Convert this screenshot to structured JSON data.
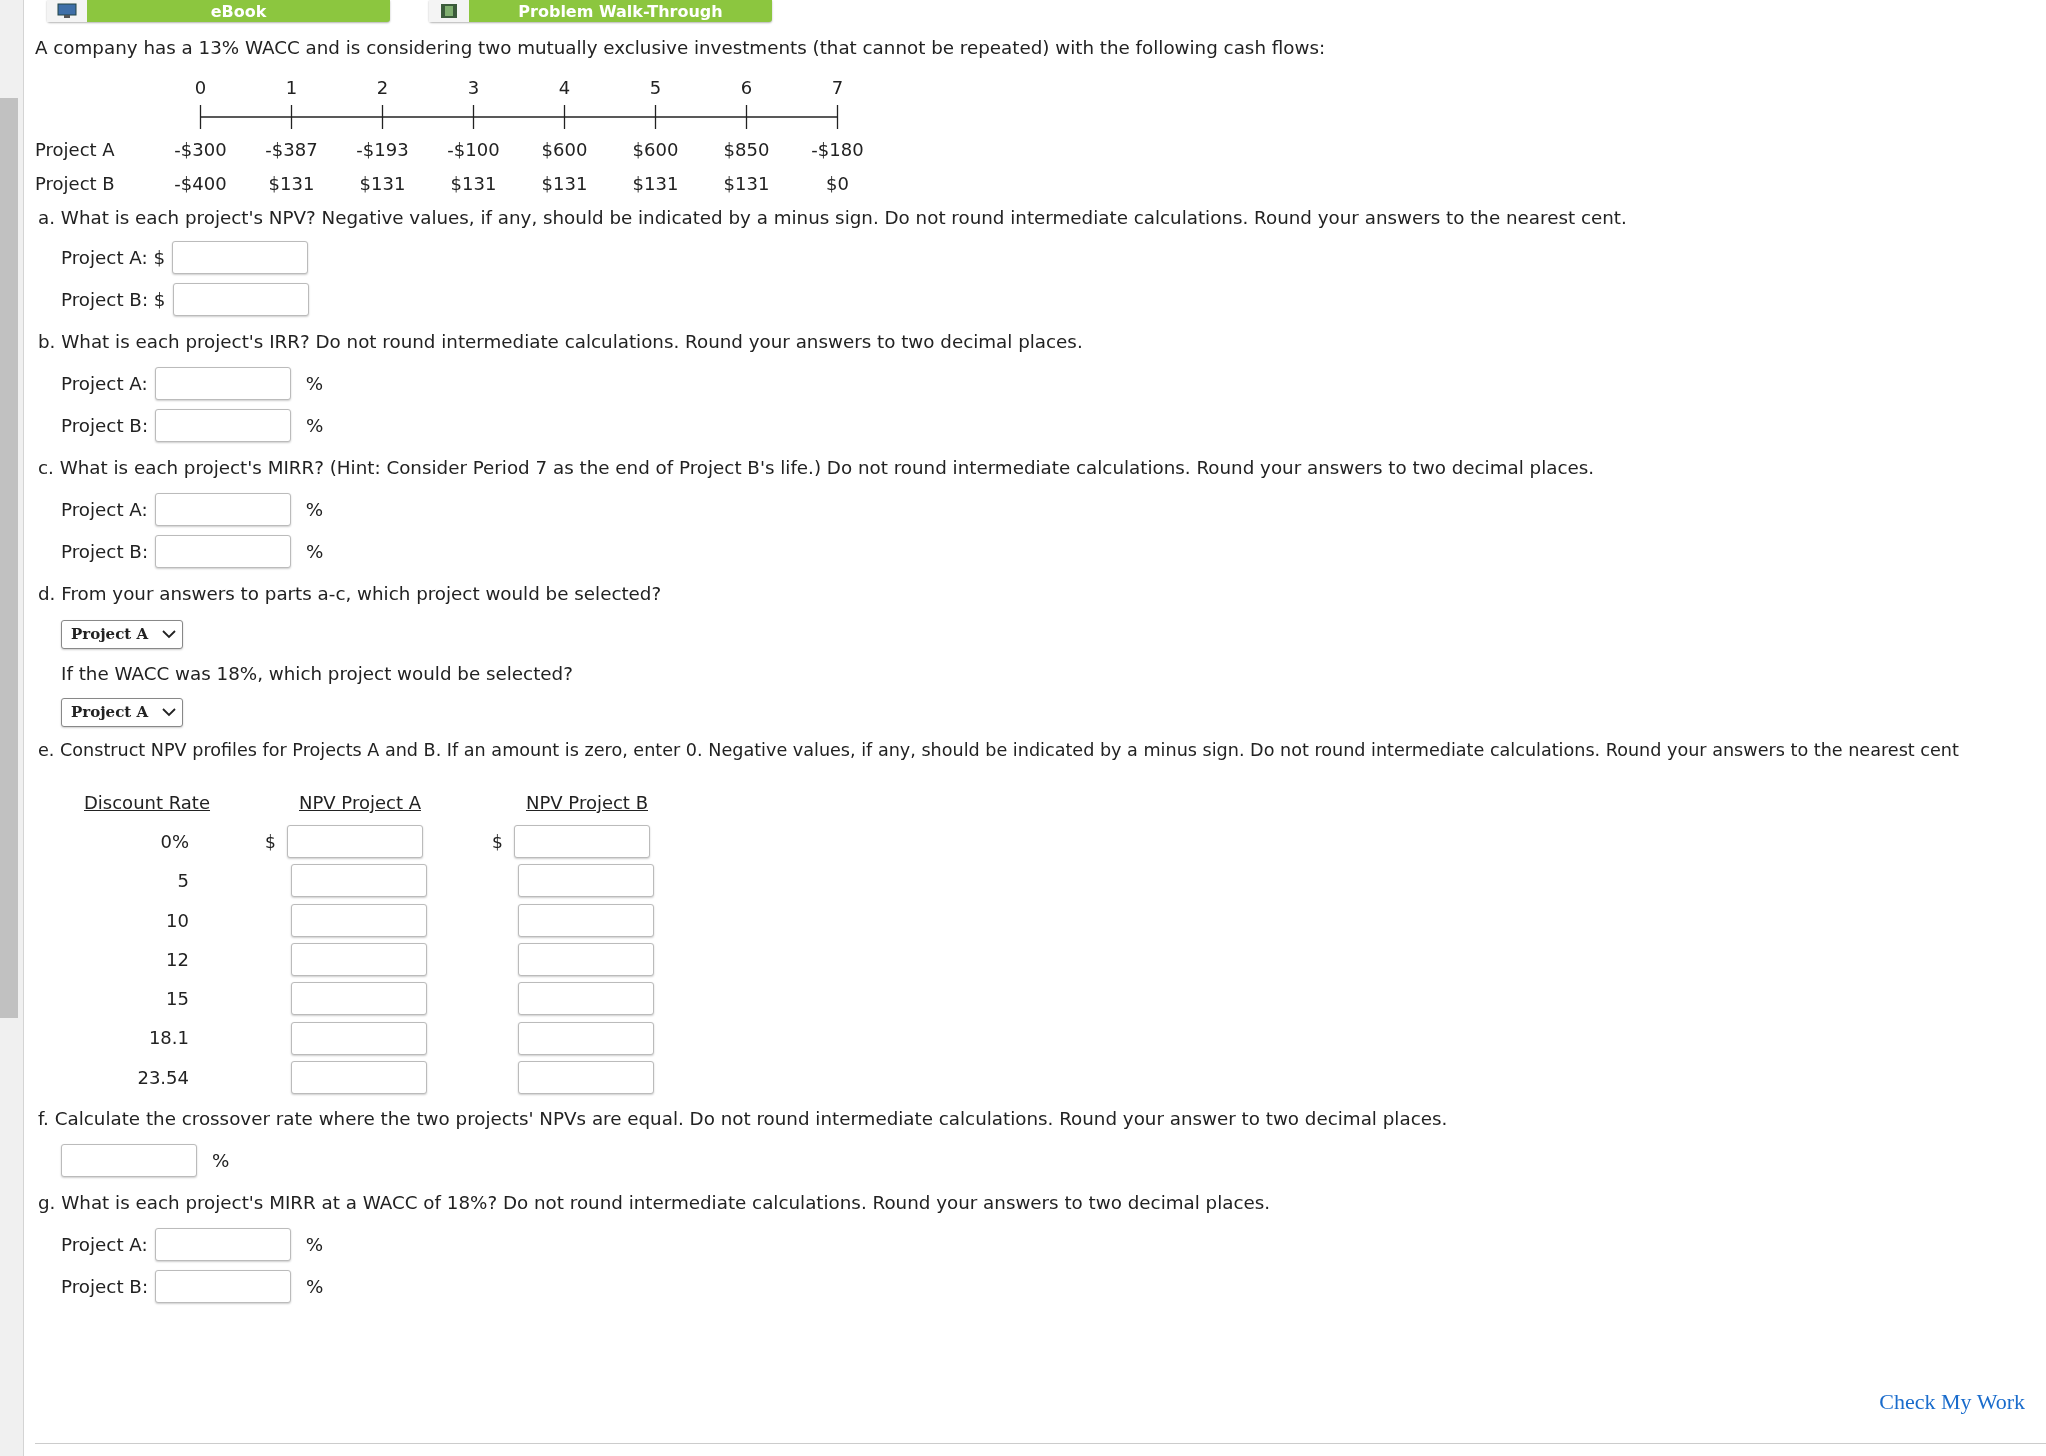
{
  "toolbar": {
    "buttons": [
      {
        "label": "eBook",
        "kind": "book"
      },
      {
        "label": "Problem Walk-Through",
        "kind": "video"
      }
    ]
  },
  "intro": "A company has a 13% WACC and is considering two mutually exclusive investments (that cannot be repeated) with the following cash flows:",
  "cash_flows": {
    "periods": [
      "0",
      "1",
      "2",
      "3",
      "4",
      "5",
      "6",
      "7"
    ],
    "rows": [
      {
        "label": "Project A",
        "values": [
          "-$300",
          "-$387",
          "-$193",
          "-$100",
          "$600",
          "$600",
          "$850",
          "-$180"
        ]
      },
      {
        "label": "Project B",
        "values": [
          "-$400",
          "$131",
          "$131",
          "$131",
          "$131",
          "$131",
          "$131",
          "$0"
        ]
      }
    ]
  },
  "questions": [
    {
      "text": "a. What is each project's NPV? Negative values, if any, should be indicated by a minus sign. Do not round intermediate calculations. Round your answers to the nearest cent.",
      "items": [
        {
          "kind": "field",
          "label": "Project A: $"
        },
        {
          "kind": "field",
          "label": "Project B: $"
        }
      ]
    },
    {
      "text": "b. What is each project's IRR? Do not round intermediate calculations. Round your answers to two decimal places.",
      "items": [
        {
          "kind": "field",
          "label": "Project A:",
          "unit": "%"
        },
        {
          "kind": "field",
          "label": "Project B:",
          "unit": "%"
        }
      ]
    },
    {
      "text": "c. What is each project's MIRR? (Hint: Consider Period 7 as the end of Project B's life.) Do not round intermediate calculations. Round your answers to two decimal places.",
      "items": [
        {
          "kind": "field",
          "label": "Project A:",
          "unit": "%"
        },
        {
          "kind": "field",
          "label": "Project B:",
          "unit": "%"
        }
      ]
    },
    {
      "text": "d. From your answers to parts a-c, which project would be selected?",
      "items": [
        {
          "kind": "select",
          "value": "Project A"
        },
        {
          "kind": "text",
          "text": "If the WACC was 18%, which project would be selected?"
        },
        {
          "kind": "select",
          "value": "Project A"
        }
      ]
    },
    {
      "text": "e. Construct NPV profiles for Projects A and B. If an amount is zero, enter 0. Negative values, if any, should be indicated by a minus sign. Do not round intermediate calculations. Round your answers to the nearest cent",
      "table": {
        "columns": [
          "Discount Rate",
          "NPV Project A",
          "NPV Project B"
        ],
        "rows": [
          {
            "rate": "0%",
            "prefix_a": "$",
            "prefix_b": "$"
          },
          {
            "rate": "5"
          },
          {
            "rate": "10"
          },
          {
            "rate": "12"
          },
          {
            "rate": "15"
          },
          {
            "rate": "18.1"
          },
          {
            "rate": "23.54"
          }
        ]
      }
    },
    {
      "text": "f. Calculate the crossover rate where the two projects' NPVs are equal. Do not round intermediate calculations. Round your answer to two decimal places.",
      "items": [
        {
          "kind": "field",
          "unit": "%"
        }
      ]
    },
    {
      "text": "g. What is each project's MIRR at a WACC of 18%? Do not round intermediate calculations. Round your answers to two decimal places.",
      "items": [
        {
          "kind": "field",
          "label": "Project A:",
          "unit": "%"
        },
        {
          "kind": "field",
          "label": "Project B:",
          "unit": "%"
        }
      ]
    }
  ],
  "check_link": "Check My Work"
}
